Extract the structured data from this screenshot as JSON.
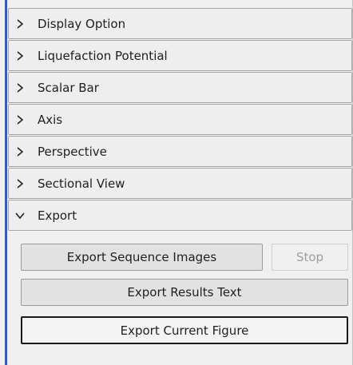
{
  "sections": [
    {
      "label": "Display Option",
      "expanded": false,
      "icon": "chevron-right-icon"
    },
    {
      "label": "Liquefaction Potential",
      "expanded": false,
      "icon": "chevron-right-icon"
    },
    {
      "label": "Scalar Bar",
      "expanded": false,
      "icon": "chevron-right-icon"
    },
    {
      "label": "Axis",
      "expanded": false,
      "icon": "chevron-right-icon"
    },
    {
      "label": "Perspective",
      "expanded": false,
      "icon": "chevron-right-icon"
    },
    {
      "label": "Sectional View",
      "expanded": false,
      "icon": "chevron-right-icon"
    },
    {
      "label": "Export",
      "expanded": true,
      "icon": "chevron-down-icon"
    }
  ],
  "export": {
    "sequence_images_label": "Export Sequence Images",
    "stop_label": "Stop",
    "stop_enabled": false,
    "results_text_label": "Export Results Text",
    "current_figure_label": "Export Current Figure"
  },
  "colors": {
    "accent": "#2d5bd7",
    "panel_bg": "#f0f0f0",
    "border": "#a6a6a6"
  }
}
